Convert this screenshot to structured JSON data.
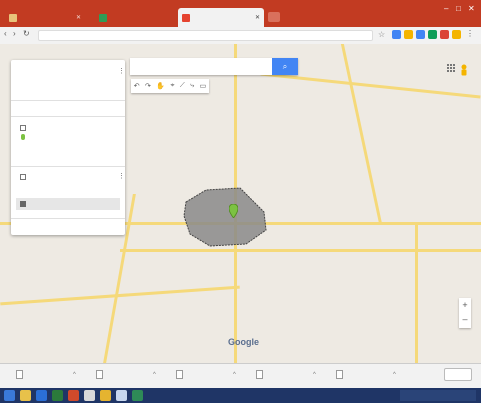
{
  "browser": {
    "tabs": [
      {
        "title": "",
        "favicon_color": "#e8c37a"
      },
      {
        "title": "",
        "favicon_color": "#2e9c56"
      },
      {
        "title": "",
        "favicon_color": "#e5432f"
      }
    ],
    "address": ""
  },
  "panel": {
    "map_title": "",
    "map_subtitle": "",
    "actions": "",
    "layer1_name": "",
    "layer1_item1": "",
    "layer1_item2": "",
    "layer2_name": "",
    "layer2_sub": "",
    "layer2_item": "",
    "base_map": ""
  },
  "map_labels": [
    "",
    "",
    "",
    "",
    "",
    "",
    "",
    "",
    "",
    "",
    "",
    "",
    "",
    "",
    "",
    "",
    "",
    "",
    "",
    "",
    "",
    "",
    "",
    "",
    "",
    "",
    "",
    "",
    "",
    "",
    "",
    "",
    "",
    ""
  ],
  "google_logo": "Google",
  "downloads": [
    {
      "name": ""
    },
    {
      "name": ""
    },
    {
      "name": ""
    },
    {
      "name": ""
    },
    {
      "name": ""
    }
  ],
  "show_all_label": "",
  "colors": {
    "tabbar": "#c23b22",
    "accent": "#4285f4",
    "polygon_fill": "#8a8a8a",
    "marker": "#7cc242",
    "road": "#f5d97a",
    "taskbar": "#1f3566"
  }
}
